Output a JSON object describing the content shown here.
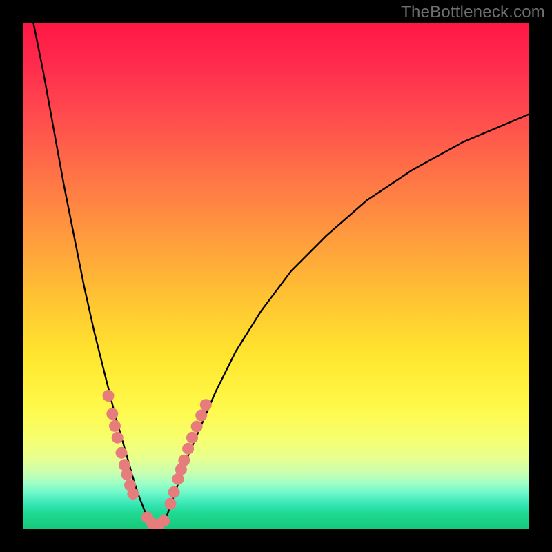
{
  "watermark": "TheBottleneck.com",
  "chart_data": {
    "type": "line",
    "title": "",
    "xlabel": "",
    "ylabel": "",
    "xlim": [
      0,
      100
    ],
    "ylim": [
      0,
      100
    ],
    "series": [
      {
        "name": "left-curve",
        "x": [
          2,
          4,
          6,
          8,
          10,
          12,
          14,
          16,
          18,
          19,
          20,
          21,
          22,
          23,
          24,
          25
        ],
        "y": [
          100,
          90,
          79,
          68,
          58,
          48,
          39,
          31,
          23,
          19.5,
          16,
          12.5,
          9,
          6,
          3.5,
          1.5
        ]
      },
      {
        "name": "trough",
        "x": [
          25,
          26,
          27,
          28
        ],
        "y": [
          1.5,
          0.7,
          0.7,
          1.5
        ]
      },
      {
        "name": "right-curve",
        "x": [
          28,
          30,
          32,
          35,
          38,
          42,
          47,
          53,
          60,
          68,
          77,
          87,
          100
        ],
        "y": [
          1.5,
          7,
          13,
          20,
          27,
          35,
          43,
          51,
          58,
          65,
          71,
          76.5,
          82
        ]
      }
    ],
    "markers": {
      "name": "highlight-dots",
      "color": "#e77c7c",
      "points_xy": [
        [
          16.8,
          26.3
        ],
        [
          17.6,
          22.7
        ],
        [
          18.1,
          20.3
        ],
        [
          18.6,
          18.0
        ],
        [
          19.4,
          15.0
        ],
        [
          20.0,
          12.6
        ],
        [
          20.5,
          10.7
        ],
        [
          21.1,
          8.6
        ],
        [
          21.7,
          6.9
        ],
        [
          24.5,
          2.2
        ],
        [
          25.5,
          1.0
        ],
        [
          26.8,
          0.8
        ],
        [
          27.8,
          1.5
        ],
        [
          29.1,
          4.9
        ],
        [
          29.8,
          7.2
        ],
        [
          30.6,
          9.8
        ],
        [
          31.2,
          11.7
        ],
        [
          31.8,
          13.5
        ],
        [
          32.6,
          15.8
        ],
        [
          33.4,
          18.0
        ],
        [
          34.3,
          20.2
        ],
        [
          35.2,
          22.4
        ],
        [
          36.1,
          24.5
        ]
      ]
    },
    "colors": {
      "curve": "#000000",
      "marker_fill": "#e77c7c",
      "background_top": "#ff1744",
      "background_bottom": "#17c97a"
    }
  }
}
